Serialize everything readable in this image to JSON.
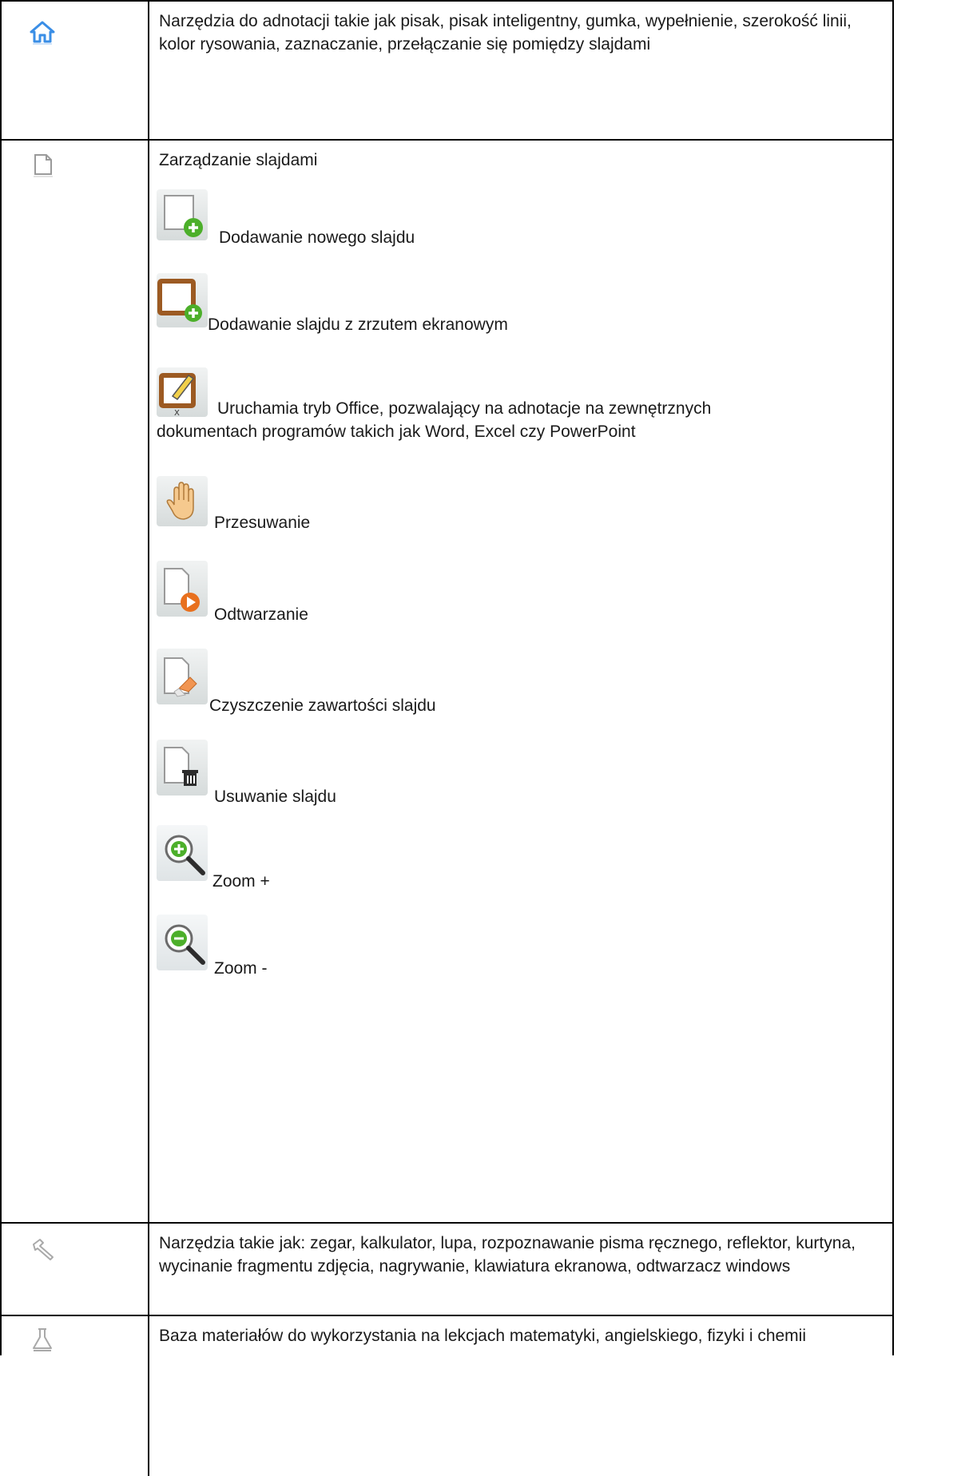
{
  "rows": [
    {
      "icon": "home-icon",
      "text": "Narzędzia do adnotacji takie jak pisak, pisak inteligentny, gumka, wypełnienie, szerokość linii, kolor rysowania, zaznaczanie, przełączanie się pomiędzy slajdami"
    },
    {
      "icon": "page-icon",
      "heading": "Zarządzanie slajdami",
      "items": [
        {
          "icon": "add-slide-icon",
          "label": "Dodawanie nowego slajdu"
        },
        {
          "icon": "add-screenshot-slide-icon",
          "label": "Dodawanie slajdu z zrzutem ekranowym"
        },
        {
          "icon": "office-mode-icon",
          "label": "Uruchamia tryb Office, pozwalający na adnotacje na zewnętrznych",
          "label2": "dokumentach programów takich jak Word, Excel czy PowerPoint"
        },
        {
          "icon": "hand-icon",
          "label": "Przesuwanie"
        },
        {
          "icon": "play-icon",
          "label": "Odtwarzanie"
        },
        {
          "icon": "clear-slide-icon",
          "label": "Czyszczenie zawartości slajdu"
        },
        {
          "icon": "delete-slide-icon",
          "label": "Usuwanie slajdu"
        },
        {
          "icon": "zoom-in-icon",
          "label": "Zoom +"
        },
        {
          "icon": "zoom-out-icon",
          "label": "Zoom -"
        }
      ]
    },
    {
      "icon": "hammer-icon",
      "text": "Narzędzia takie jak: zegar, kalkulator, lupa, rozpoznawanie pisma ręcznego, reflektor, kurtyna, wycinanie fragmentu zdjęcia, nagrywanie, klawiatura ekranowa, odtwarzacz windows"
    },
    {
      "icon": "flask-icon",
      "text": "Baza materiałów do wykorzystania na lekcjach matematyki, angielskiego, fizyki i chemii"
    }
  ],
  "colors": {
    "home_icon": "#3a8ee6",
    "gray_icon": "#a9a9a9",
    "green_plus": "#4caf2a",
    "orange_play": "#e8701e",
    "brown_frame": "#9c5a22"
  }
}
